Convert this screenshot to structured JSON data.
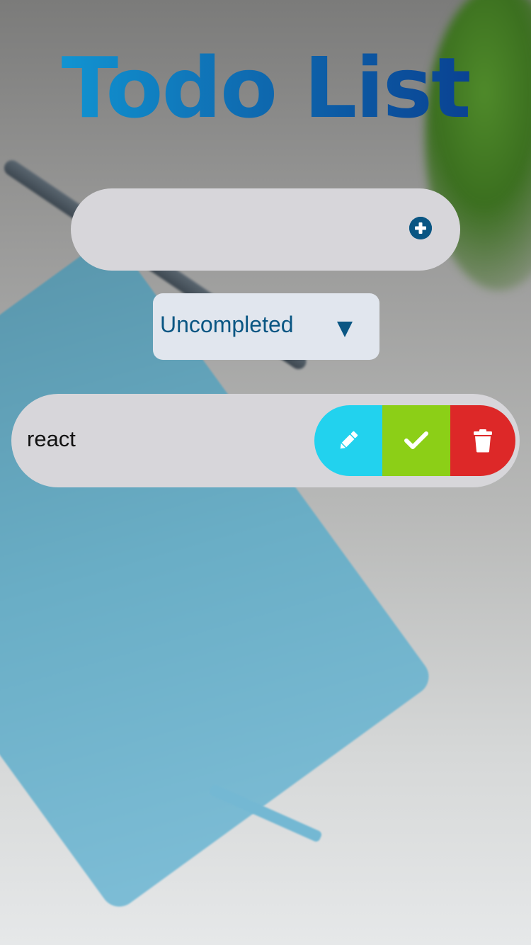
{
  "header": {
    "title": "Todo List"
  },
  "add_form": {
    "input_value": "",
    "input_placeholder": "",
    "add_icon": "plus-circle-icon"
  },
  "filter": {
    "selected": "Uncompleted",
    "dropdown_icon": "chevron-down-icon"
  },
  "todos": [
    {
      "text": "react",
      "actions": [
        {
          "name": "edit",
          "icon": "pencil-icon",
          "color": "#22d2ee"
        },
        {
          "name": "complete",
          "icon": "check-icon",
          "color": "#8ccf17"
        },
        {
          "name": "delete",
          "icon": "trash-icon",
          "color": "#dd2828"
        }
      ]
    }
  ],
  "colors": {
    "accent": "#0a5683",
    "title_gradient_start": "#12a1dc",
    "title_gradient_end": "#08378a",
    "surface": "#d7d6da",
    "select_bg": "#e1e6ee"
  }
}
